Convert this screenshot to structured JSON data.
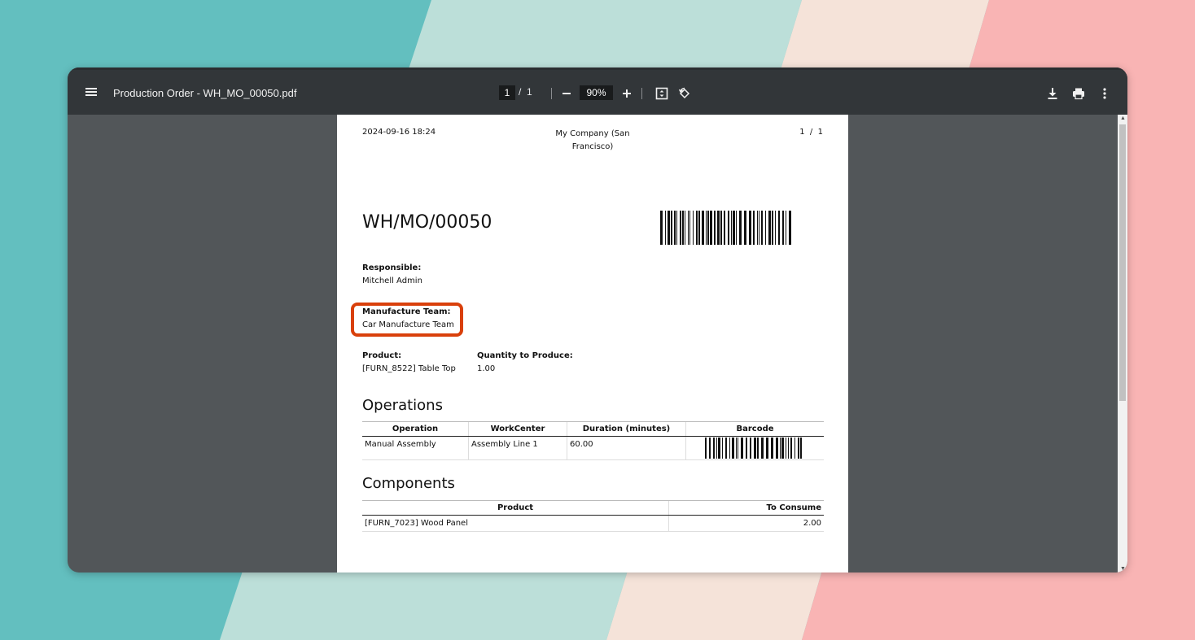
{
  "colors": {
    "band1": "#63bfbf",
    "band2": "#bcdfd9",
    "band3": "#f5e3d9",
    "band4": "#f9b4b4",
    "toolbar": "#323639",
    "viewer": "#525659",
    "highlight": "#d9400b"
  },
  "viewer": {
    "title": "Production Order - WH_MO_00050.pdf",
    "page_current": "1",
    "page_total": "/  1",
    "zoom": "90%",
    "icons": [
      "menu-icon",
      "zoom-out-icon",
      "zoom-in-icon",
      "fit-page-icon",
      "rotate-icon",
      "download-icon",
      "print-icon",
      "more-icon"
    ]
  },
  "doc": {
    "datetime": "2024-09-16 18:24",
    "company_line1": "My Company (San",
    "company_line2": "Francisco)",
    "page_counter": "1  /  1",
    "reference": "WH/MO/00050",
    "responsible_label": "Responsible:",
    "responsible_value": "Mitchell Admin",
    "team_label": "Manufacture Team:",
    "team_value": "Car Manufacture Team",
    "product_label": "Product:",
    "product_value": "[FURN_8522] Table Top",
    "qty_label": "Quantity to Produce:",
    "qty_value": "1.00",
    "operations_heading": "Operations",
    "operations": {
      "headers": [
        "Operation",
        "WorkCenter",
        "Duration (minutes)",
        "Barcode"
      ],
      "rows": [
        [
          "Manual Assembly",
          "Assembly Line 1",
          "60.00"
        ]
      ]
    },
    "components_heading": "Components",
    "components": {
      "headers": [
        "Product",
        "To Consume"
      ],
      "rows": [
        [
          "[FURN_7023] Wood Panel",
          "2.00"
        ]
      ]
    }
  }
}
